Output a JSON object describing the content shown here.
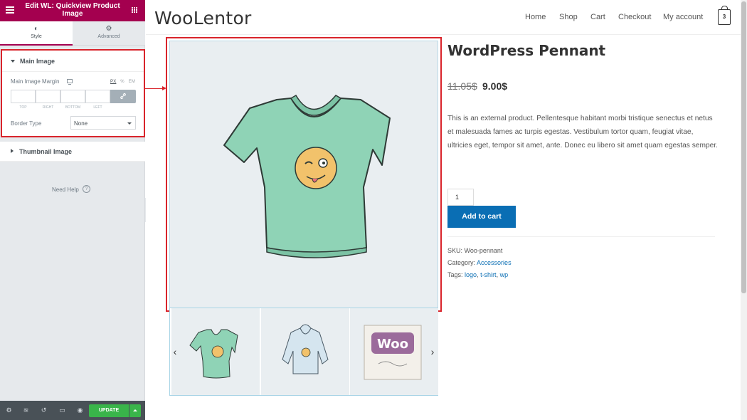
{
  "panel": {
    "title": "Edit WL: Quickview Product Image",
    "tabs": [
      {
        "label": "Style",
        "icon": "half-circle-icon"
      },
      {
        "label": "Advanced",
        "icon": "gear-icon"
      }
    ],
    "main_section": {
      "title": "Main Image",
      "margin_label": "Main Image Margin",
      "units": [
        "PX",
        "%",
        "EM"
      ],
      "active_unit": "PX",
      "dimension_labels": [
        "TOP",
        "RIGHT",
        "BOTTOM",
        "LEFT"
      ],
      "border_type_label": "Border Type",
      "border_type_value": "None"
    },
    "thumb_section": {
      "title": "Thumbnail Image"
    },
    "need_help": "Need Help",
    "footer": {
      "update_label": "UPDATE"
    },
    "colors": {
      "header": "#a4004f",
      "update": "#39b54a",
      "highlight": "#d9242b"
    }
  },
  "site": {
    "logo": "WooLentor",
    "nav": [
      "Home",
      "Shop",
      "Cart",
      "Checkout",
      "My account"
    ],
    "cart_count": "3",
    "product": {
      "title": "WordPress Pennant",
      "price_old": "11.05$",
      "price_new": "9.00$",
      "description": "This is an external product. Pellentesque habitant morbi tristique senectus et netus et malesuada fames ac turpis egestas. Vestibulum tortor quam, feugiat vitae, ultricies eget, tempor sit amet, ante. Donec eu libero sit amet quam egestas semper.",
      "quantity": "1",
      "add_to_cart": "Add to cart",
      "sku_label": "SKU:",
      "sku": "Woo-pennant",
      "category_label": "Category:",
      "category": "Accessories",
      "tags_label": "Tags:",
      "tags": [
        "logo",
        "t-shirt",
        "wp"
      ]
    },
    "thumbnail_logo_text": "Woo",
    "colors": {
      "button": "#0a6eb4",
      "shirt": "#8fd3b6"
    }
  }
}
